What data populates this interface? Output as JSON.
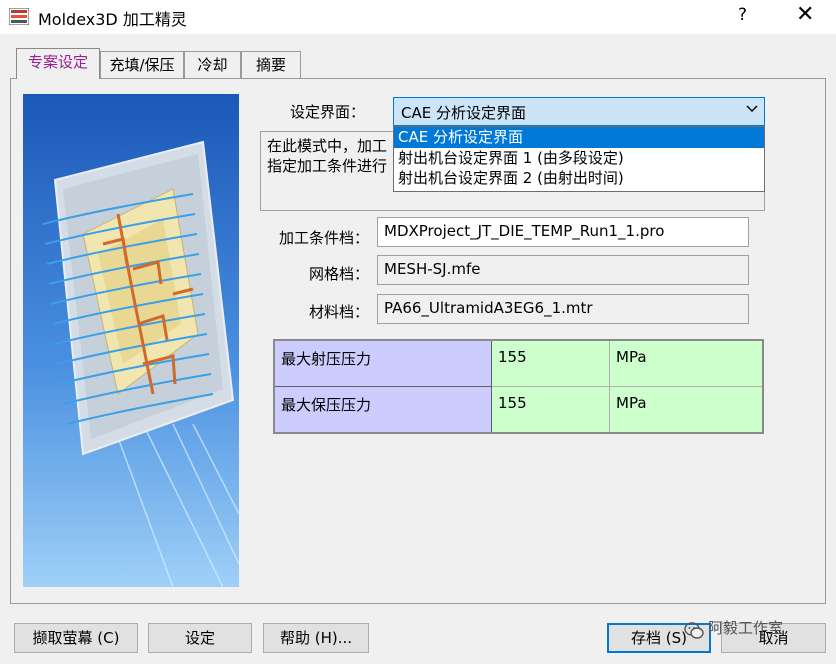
{
  "window": {
    "title": "Moldex3D 加工精灵",
    "help_glyph": "?",
    "close_glyph": "✕",
    "app_icon": "moldex-app-icon"
  },
  "tabs": [
    {
      "label": "专案设定",
      "active": true
    },
    {
      "label": "充填/保压",
      "active": false
    },
    {
      "label": "冷却",
      "active": false
    },
    {
      "label": "摘要",
      "active": false
    }
  ],
  "settings": {
    "interface_label": "设定界面：",
    "interface_value": "CAE 分析设定界面",
    "dropdown_arrow_icon": "chevron-down-icon",
    "options": [
      "CAE 分析设定界面",
      "射出机台设定界面 1 (由多段设定)",
      "射出机台设定界面 2 (由射出时间)"
    ]
  },
  "description": {
    "line1": "在此模式中，加工",
    "line2": "指定加工条件进行"
  },
  "files": {
    "process_label": "加工条件档：",
    "process_value": "MDXProject_JT_DIE_TEMP_Run1_1.pro",
    "mesh_label": "网格档：",
    "mesh_value": "MESH-SJ.mfe",
    "material_label": "材料档：",
    "material_value": "PA66_UltramidA3EG6_1.mtr"
  },
  "pressure_table": {
    "rows": [
      {
        "name": "最大射压压力",
        "value": "155",
        "unit": "MPa"
      },
      {
        "name": "最大保压压力",
        "value": "155",
        "unit": "MPa"
      }
    ],
    "colors": {
      "header": "#ccccff",
      "value": "#ccffcc"
    }
  },
  "buttons": {
    "capture": "撷取萤幕 (C)",
    "settings": "设定",
    "help": "帮助 (H)...",
    "save": "存档 (S)",
    "cancel": "取消"
  },
  "watermark": {
    "text": "阿毅工作室",
    "icon": "wechat-icon"
  },
  "colors": {
    "active_tab_text": "#9b1e8f",
    "selection": "#0078d7",
    "combo_bg": "#cce4f7"
  }
}
